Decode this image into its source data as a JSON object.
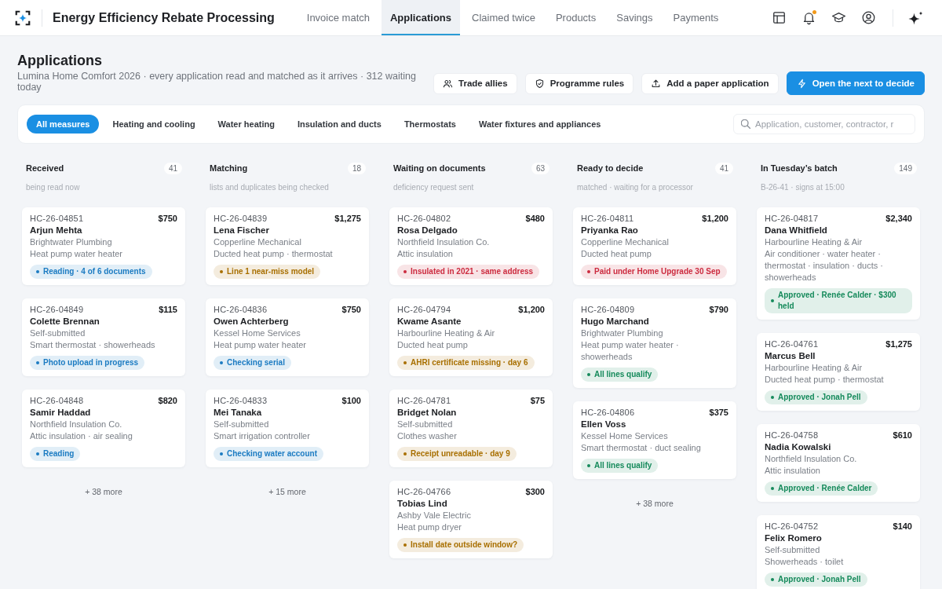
{
  "app": {
    "title": "Energy Efficiency Rebate Processing",
    "notifications_unread": true
  },
  "nav_tabs": [
    {
      "label": "Invoice match",
      "selected": false
    },
    {
      "label": "Applications",
      "selected": true
    },
    {
      "label": "Claimed twice",
      "selected": false
    },
    {
      "label": "Products",
      "selected": false
    },
    {
      "label": "Savings",
      "selected": false
    },
    {
      "label": "Payments",
      "selected": false
    }
  ],
  "page": {
    "title": "Applications",
    "subtitle": "Lumina Home Comfort 2026 · every application read and matched as it arrives · 312 waiting today"
  },
  "actions": [
    {
      "label": "Trade allies",
      "kind": "secondary"
    },
    {
      "label": "Programme rules",
      "kind": "secondary"
    },
    {
      "label": "Add a paper application",
      "kind": "secondary"
    },
    {
      "label": "Open the next to decide",
      "kind": "primary"
    }
  ],
  "filters": [
    {
      "label": "All measures",
      "selected": true
    },
    {
      "label": "Heating and cooling",
      "selected": false
    },
    {
      "label": "Water heating",
      "selected": false
    },
    {
      "label": "Insulation and ducts",
      "selected": false
    },
    {
      "label": "Thermostats",
      "selected": false
    },
    {
      "label": "Water fixtures and appliances",
      "selected": false
    }
  ],
  "search": {
    "placeholder": "Application, customer, contractor, r"
  },
  "columns": [
    {
      "title": "Received",
      "count": "41",
      "subtitle": "being read now",
      "cards": [
        {
          "id": "HC-26-04851",
          "amount": "$750",
          "name": "Arjun Mehta",
          "contractor": "Brightwater Plumbing",
          "measures": "Heat pump water heater",
          "status": {
            "text": "Reading · 4 of 6 documents",
            "color": "#1b7bc2"
          }
        },
        {
          "id": "HC-26-04849",
          "amount": "$115",
          "name": "Colette Brennan",
          "contractor": "Self-submitted",
          "measures": "Smart thermostat · showerheads",
          "status": {
            "text": "Photo upload in progress",
            "color": "#1b7bc2"
          }
        },
        {
          "id": "HC-26-04848",
          "amount": "$820",
          "name": "Samir Haddad",
          "contractor": "Northfield Insulation Co.",
          "measures": "Attic insulation · air sealing",
          "status": {
            "text": "Reading",
            "color": "#1b7bc2"
          }
        }
      ],
      "more": "+ 38 more"
    },
    {
      "title": "Matching",
      "count": "18",
      "subtitle": "lists and duplicates being checked",
      "cards": [
        {
          "id": "HC-26-04839",
          "amount": "$1,275",
          "name": "Lena Fischer",
          "contractor": "Copperline Mechanical",
          "measures": "Ducted heat pump · thermostat",
          "status": {
            "text": "Line 1 near-miss model",
            "color": "#a86f00"
          }
        },
        {
          "id": "HC-26-04836",
          "amount": "$750",
          "name": "Owen Achterberg",
          "contractor": "Kessel Home Services",
          "measures": "Heat pump water heater",
          "status": {
            "text": "Checking serial",
            "color": "#1b7bc2"
          }
        },
        {
          "id": "HC-26-04833",
          "amount": "$100",
          "name": "Mei Tanaka",
          "contractor": "Self-submitted",
          "measures": "Smart irrigation controller",
          "status": {
            "text": "Checking water account",
            "color": "#1b7bc2"
          }
        }
      ],
      "more": "+ 15 more"
    },
    {
      "title": "Waiting on documents",
      "count": "63",
      "subtitle": "deficiency request sent",
      "cards": [
        {
          "id": "HC-26-04802",
          "amount": "$480",
          "name": "Rosa Delgado",
          "contractor": "Northfield Insulation Co.",
          "measures": "Attic insulation",
          "status": {
            "text": "Insulated in 2021 · same address",
            "color": "#cc2b3f"
          }
        },
        {
          "id": "HC-26-04794",
          "amount": "$1,200",
          "name": "Kwame Asante",
          "contractor": "Harbourline Heating & Air",
          "measures": "Ducted heat pump",
          "status": {
            "text": "AHRI certificate missing · day 6",
            "color": "#a86f00"
          }
        },
        {
          "id": "HC-26-04781",
          "amount": "$75",
          "name": "Bridget Nolan",
          "contractor": "Self-submitted",
          "measures": "Clothes washer",
          "status": {
            "text": "Receipt unreadable · day 9",
            "color": "#a86f00"
          }
        },
        {
          "id": "HC-26-04766",
          "amount": "$300",
          "name": "Tobias Lind",
          "contractor": "Ashby Vale Electric",
          "measures": "Heat pump dryer",
          "status": {
            "text": "Install date outside window?",
            "color": "#a86f00"
          }
        }
      ]
    },
    {
      "title": "Ready to decide",
      "count": "41",
      "subtitle": "matched · waiting for a processor",
      "cards": [
        {
          "id": "HC-26-04811",
          "amount": "$1,200",
          "name": "Priyanka Rao",
          "contractor": "Copperline Mechanical",
          "measures": "Ducted heat pump",
          "status": {
            "text": "Paid under Home Upgrade 30 Sep",
            "color": "#cc2b3f"
          }
        },
        {
          "id": "HC-26-04809",
          "amount": "$790",
          "name": "Hugo Marchand",
          "contractor": "Brightwater Plumbing",
          "measures": "Heat pump water heater · showerheads",
          "status": {
            "text": "All lines qualify",
            "color": "#158a5b"
          }
        },
        {
          "id": "HC-26-04806",
          "amount": "$375",
          "name": "Ellen Voss",
          "contractor": "Kessel Home Services",
          "measures": "Smart thermostat · duct sealing",
          "status": {
            "text": "All lines qualify",
            "color": "#158a5b"
          }
        }
      ],
      "more": "+ 38 more"
    },
    {
      "title": "In Tuesday’s batch",
      "count": "149",
      "subtitle": "B-26-41 · signs at 15:00",
      "cards": [
        {
          "id": "HC-26-04817",
          "amount": "$2,340",
          "name": "Dana Whitfield",
          "contractor": "Harbourline Heating & Air",
          "measures": "Air conditioner · water heater · thermostat · insulation · ducts · showerheads",
          "status": {
            "text": "Approved · Renée Calder · $300 held",
            "color": "#158a5b"
          }
        },
        {
          "id": "HC-26-04761",
          "amount": "$1,275",
          "name": "Marcus Bell",
          "contractor": "Harbourline Heating & Air",
          "measures": "Ducted heat pump · thermostat",
          "status": {
            "text": "Approved · Jonah Pell",
            "color": "#158a5b"
          }
        },
        {
          "id": "HC-26-04758",
          "amount": "$610",
          "name": "Nadia Kowalski",
          "contractor": "Northfield Insulation Co.",
          "measures": "Attic insulation",
          "status": {
            "text": "Approved · Renée Calder",
            "color": "#158a5b"
          }
        },
        {
          "id": "HC-26-04752",
          "amount": "$140",
          "name": "Felix Romero",
          "contractor": "Self-submitted",
          "measures": "Showerheads · toilet",
          "status": {
            "text": "Approved · Jonah Pell",
            "color": "#158a5b"
          }
        }
      ]
    }
  ]
}
